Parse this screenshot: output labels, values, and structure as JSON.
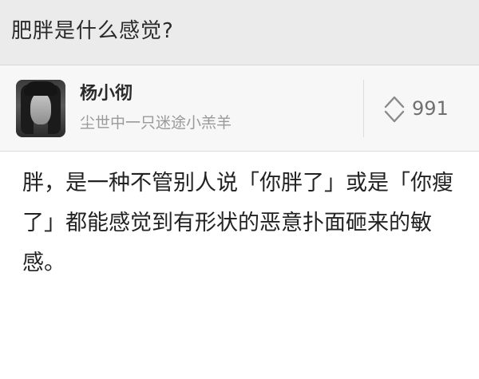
{
  "question": {
    "title": "肥胖是什么感觉?"
  },
  "author": {
    "name": "杨小彻",
    "bio": "尘世中一只迷途小羔羊",
    "avatar_icon": "avatar-portrait"
  },
  "votes": {
    "icon": "vote-up-down-icon",
    "count": "991"
  },
  "answer": {
    "text": "胖，是一种不管别人说「你胖了」或是「你瘦了」都能感觉到有形状的恶意扑面砸来的敏感。"
  }
}
